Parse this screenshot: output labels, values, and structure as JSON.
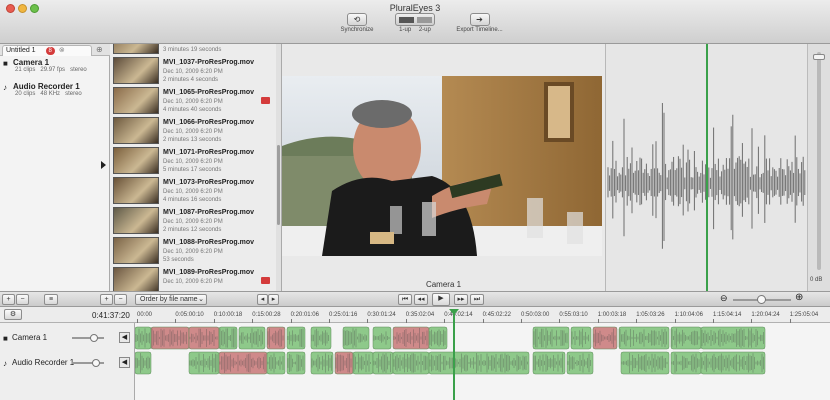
{
  "window": {
    "title": "PluralEyes 3"
  },
  "toolbar": {
    "synchronize": "Synchronize",
    "up1": "1-up",
    "up2": "2-up",
    "export": "Export Timeline..."
  },
  "project": {
    "tab": "Untitled 1",
    "tab_badge": "8",
    "sources": [
      {
        "name": "Camera 1",
        "clips": "21 clips",
        "rate": "29.97 fps",
        "channels": "stereo"
      },
      {
        "name": "Audio Recorder 1",
        "clips": "20 clips",
        "rate": "48 KHz",
        "channels": "stereo"
      }
    ]
  },
  "clips": [
    {
      "name": "",
      "date": "Dec 10, 2009 6:20 PM",
      "duration": "3 minutes 19 seconds",
      "flag": false
    },
    {
      "name": "MVI_1037-ProResProg.mov",
      "date": "Dec 10, 2009 6:20 PM",
      "duration": "2 minutes 4 seconds",
      "flag": false
    },
    {
      "name": "MVI_1065-ProResProg.mov",
      "date": "Dec 10, 2009 6:20 PM",
      "duration": "4 minutes 40 seconds",
      "flag": true
    },
    {
      "name": "MVI_1066-ProResProg.mov",
      "date": "Dec 10, 2009 6:20 PM",
      "duration": "2 minutes 13 seconds",
      "flag": false
    },
    {
      "name": "MVI_1071-ProResProg.mov",
      "date": "Dec 10, 2009 6:20 PM",
      "duration": "5 minutes 17 seconds",
      "flag": false
    },
    {
      "name": "MVI_1073-ProResProg.mov",
      "date": "Dec 10, 2009 6:20 PM",
      "duration": "4 minutes 16 seconds",
      "flag": false
    },
    {
      "name": "MVI_1087-ProResProg.mov",
      "date": "Dec 10, 2009 6:20 PM",
      "duration": "2 minutes 12 seconds",
      "flag": false
    },
    {
      "name": "MVI_1088-ProResProg.mov",
      "date": "Dec 10, 2009 6:20 PM",
      "duration": "53 seconds",
      "flag": false
    },
    {
      "name": "MVI_1089-ProResProg.mov",
      "date": "Dec 10, 2009 6:20 PM",
      "duration": "",
      "flag": true
    }
  ],
  "viewer": {
    "camera_label": "Camera 1"
  },
  "meter": {
    "db": "0 dB"
  },
  "controls": {
    "sort": "Order by file name",
    "add": "+",
    "remove": "−"
  },
  "timeline": {
    "timecode": "0:41:37:20",
    "tracks": [
      "Camera 1",
      "Audio Recorder 1"
    ],
    "ruler": [
      "00:00",
      "0:05:00:10",
      "0:10:00:18",
      "0:15:00:28",
      "0:20:01:06",
      "0:25:01:16",
      "0:30:01:24",
      "0:35:02:04",
      "0:40:02:14",
      "0:45:02:22",
      "0:50:03:00",
      "0:55:03:10",
      "1:00:03:18",
      "1:05:03:26",
      "1:10:04:06",
      "1:15:04:14",
      "1:20:04:24",
      "1:25:05:04"
    ]
  },
  "colors": {
    "clip_green": "#8ec98a",
    "clip_red": "#cf8a8a",
    "playhead": "#3aa04a"
  }
}
